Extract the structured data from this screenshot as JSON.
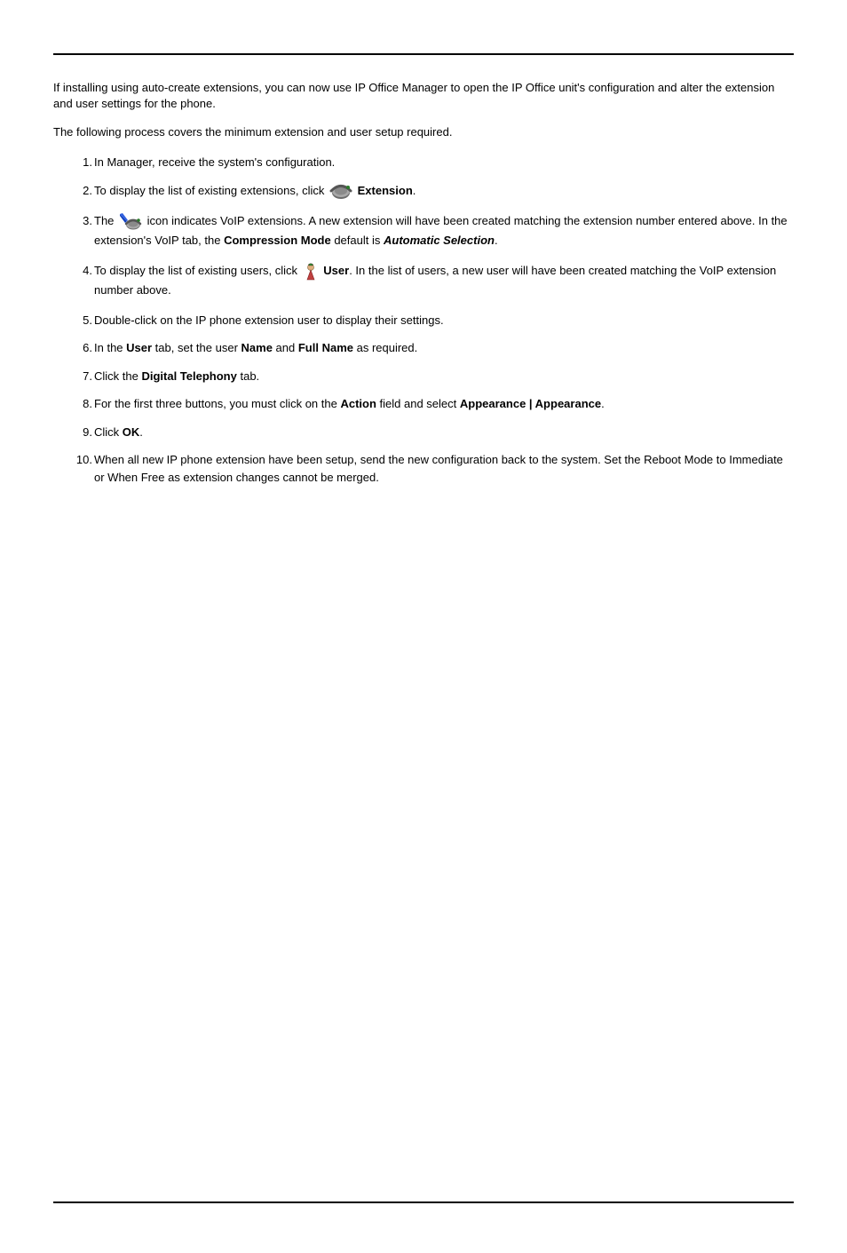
{
  "intro": {
    "p1": "If installing using auto-create extensions, you can now use IP Office Manager to open the IP Office unit's configuration and alter the extension and user settings for the phone.",
    "p2": "The following process covers the minimum extension and user setup required."
  },
  "steps": {
    "s1": "In Manager, receive the system's configuration.",
    "s2_a": "To display the list of existing extensions, click ",
    "s2_b_strong": "Extension",
    "s2_c": ".",
    "s3_a": "The ",
    "s3_b": " icon indicates VoIP extensions. A new extension will have been created matching the extension number entered above. In the extension's VoIP tab, the ",
    "s3_c_strong": "Compression Mode",
    "s3_d": " default is ",
    "s3_e_emph": "Automatic Selection",
    "s3_f": ".",
    "s4_a": "To display the list of existing users, click ",
    "s4_b_strong": "User",
    "s4_c": ". In the list of users, a new user will have been created matching the VoIP extension number above.",
    "s5": "Double-click on the IP phone extension user to display their settings.",
    "s6_a": "In the ",
    "s6_b_strong": "User",
    "s6_c": " tab, set the user ",
    "s6_d_strong": "Name",
    "s6_e": " and ",
    "s6_f_strong": "Full Name",
    "s6_g": " as required.",
    "s7_a": "Click the ",
    "s7_b_strong": "Digital Telephony",
    "s7_c": " tab.",
    "s8_a": "For the first three buttons, you must click on the ",
    "s8_b_strong": "Action",
    "s8_c": " field and select ",
    "s8_d_strong": "Appearance | Appearance",
    "s8_e": ".",
    "s9_a": "Click ",
    "s9_b_strong": "OK",
    "s9_c": ".",
    "s10": "When all new IP phone extension have been setup, send the new configuration back to the system. Set the Reboot Mode to Immediate or When Free as extension changes cannot be merged."
  },
  "icons": {
    "extension": "extension-icon",
    "voip": "voip-extension-icon",
    "user": "user-icon"
  }
}
